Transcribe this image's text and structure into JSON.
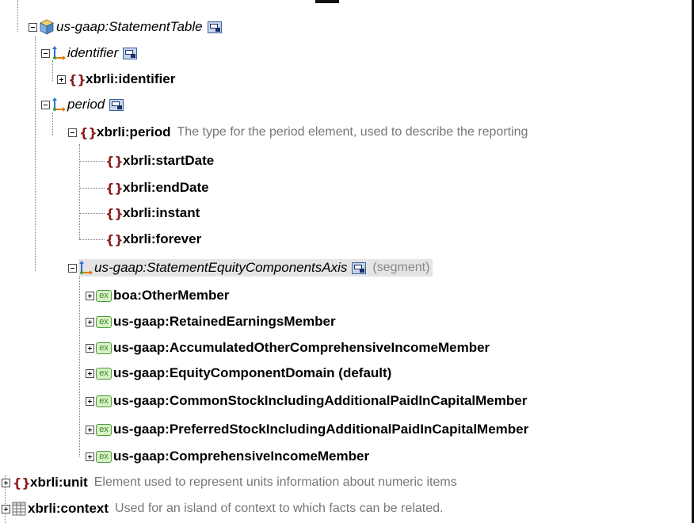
{
  "tree": {
    "statement_table": {
      "label": "us-gaap:StatementTable",
      "icon": "table-cube-icon"
    },
    "identifier_group": {
      "label": "identifier",
      "icon": "axis-icon"
    },
    "identifier_elem": {
      "label": "xbrli:identifier",
      "icon": "element-icon"
    },
    "period_group": {
      "label": "period",
      "icon": "axis-icon"
    },
    "period_elem": {
      "label": "xbrli:period",
      "description": "The type for the period element, used to describe the reporting"
    },
    "period_children": [
      "xbrli:startDate",
      "xbrli:endDate",
      "xbrli:instant",
      "xbrli:forever"
    ],
    "equity_axis": {
      "label": "us-gaap:StatementEquityComponentsAxis",
      "suffix": "(segment)"
    },
    "members": [
      "boa:OtherMember",
      "us-gaap:RetainedEarningsMember",
      "us-gaap:AccumulatedOtherComprehensiveIncomeMember",
      "us-gaap:EquityComponentDomain (default)",
      "us-gaap:CommonStockIncludingAdditionalPaidInCapitalMember",
      "us-gaap:PreferredStockIncludingAdditionalPaidInCapitalMember",
      "us-gaap:ComprehensiveIncomeMember"
    ],
    "member_icon_text": "ex",
    "unit": {
      "label": "xbrli:unit",
      "description": "Element used to represent units information about numeric items"
    },
    "context": {
      "label": "xbrli:context",
      "description": "Used for an island of context to which facts can be related."
    }
  },
  "colors": {
    "element_icon": "#8b1a1a",
    "member_icon_bg": "#d9f0c6",
    "member_icon_border": "#4a9b3a",
    "highlight": "#e4e4e4"
  }
}
